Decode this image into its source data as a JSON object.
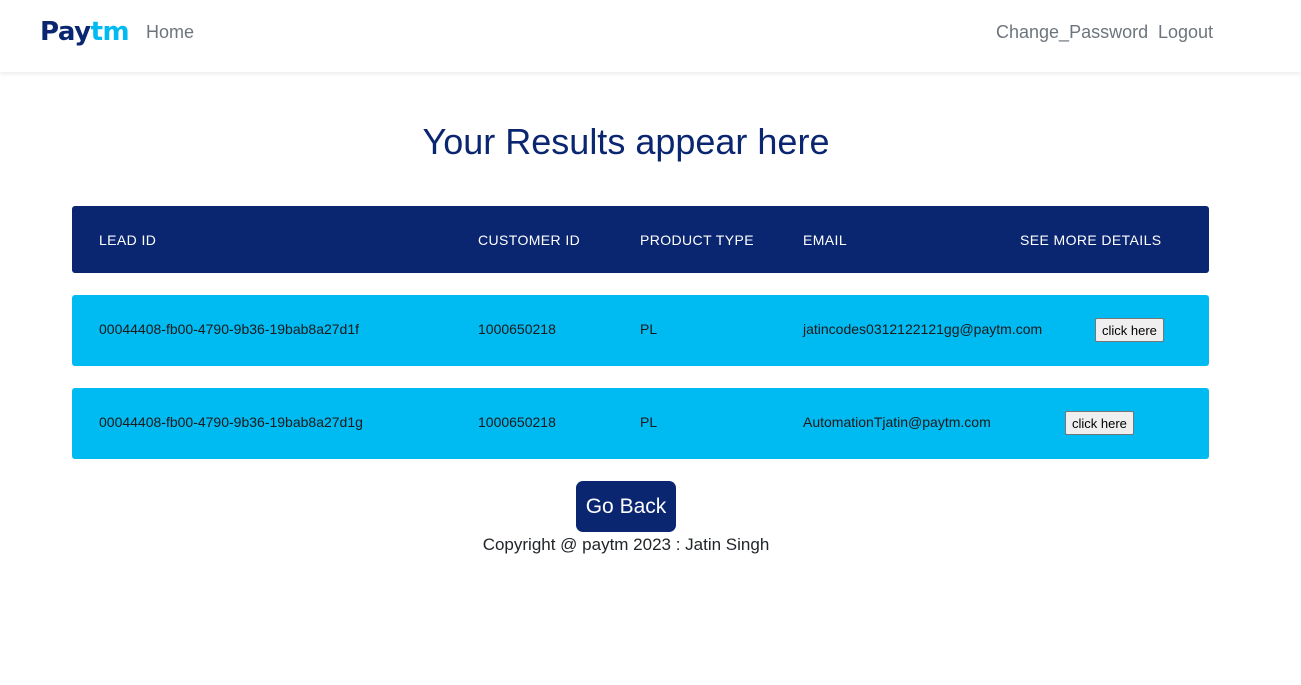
{
  "nav": {
    "brand_pay": "Pay",
    "brand_tm": "tm",
    "home": "Home",
    "change_password": "Change_Password",
    "logout": "Logout"
  },
  "page": {
    "title": "Your Results appear here"
  },
  "table": {
    "headers": [
      "LEAD ID",
      "CUSTOMER ID",
      "PRODUCT TYPE",
      "EMAIL",
      "SEE MORE DETAILS"
    ],
    "rows": [
      {
        "lead_id": "00044408-fb00-4790-9b36-19bab8a27d1f",
        "customer_id": "1000650218",
        "product_type": "PL",
        "email": "jatincodes0312122121gg@paytm.com",
        "button_label": "click here"
      },
      {
        "lead_id": "00044408-fb00-4790-9b36-19bab8a27d1g",
        "customer_id": "1000650218",
        "product_type": "PL",
        "email": "AutomationTjatin@paytm.com",
        "button_label": "click here"
      }
    ]
  },
  "footer": {
    "go_back": "Go Back",
    "copyright": "Copyright @ paytm 2023 : Jatin Singh"
  },
  "colors": {
    "primary_navy": "#0b2670",
    "accent_cyan": "#00baf2",
    "nav_text": "#6c757d"
  }
}
